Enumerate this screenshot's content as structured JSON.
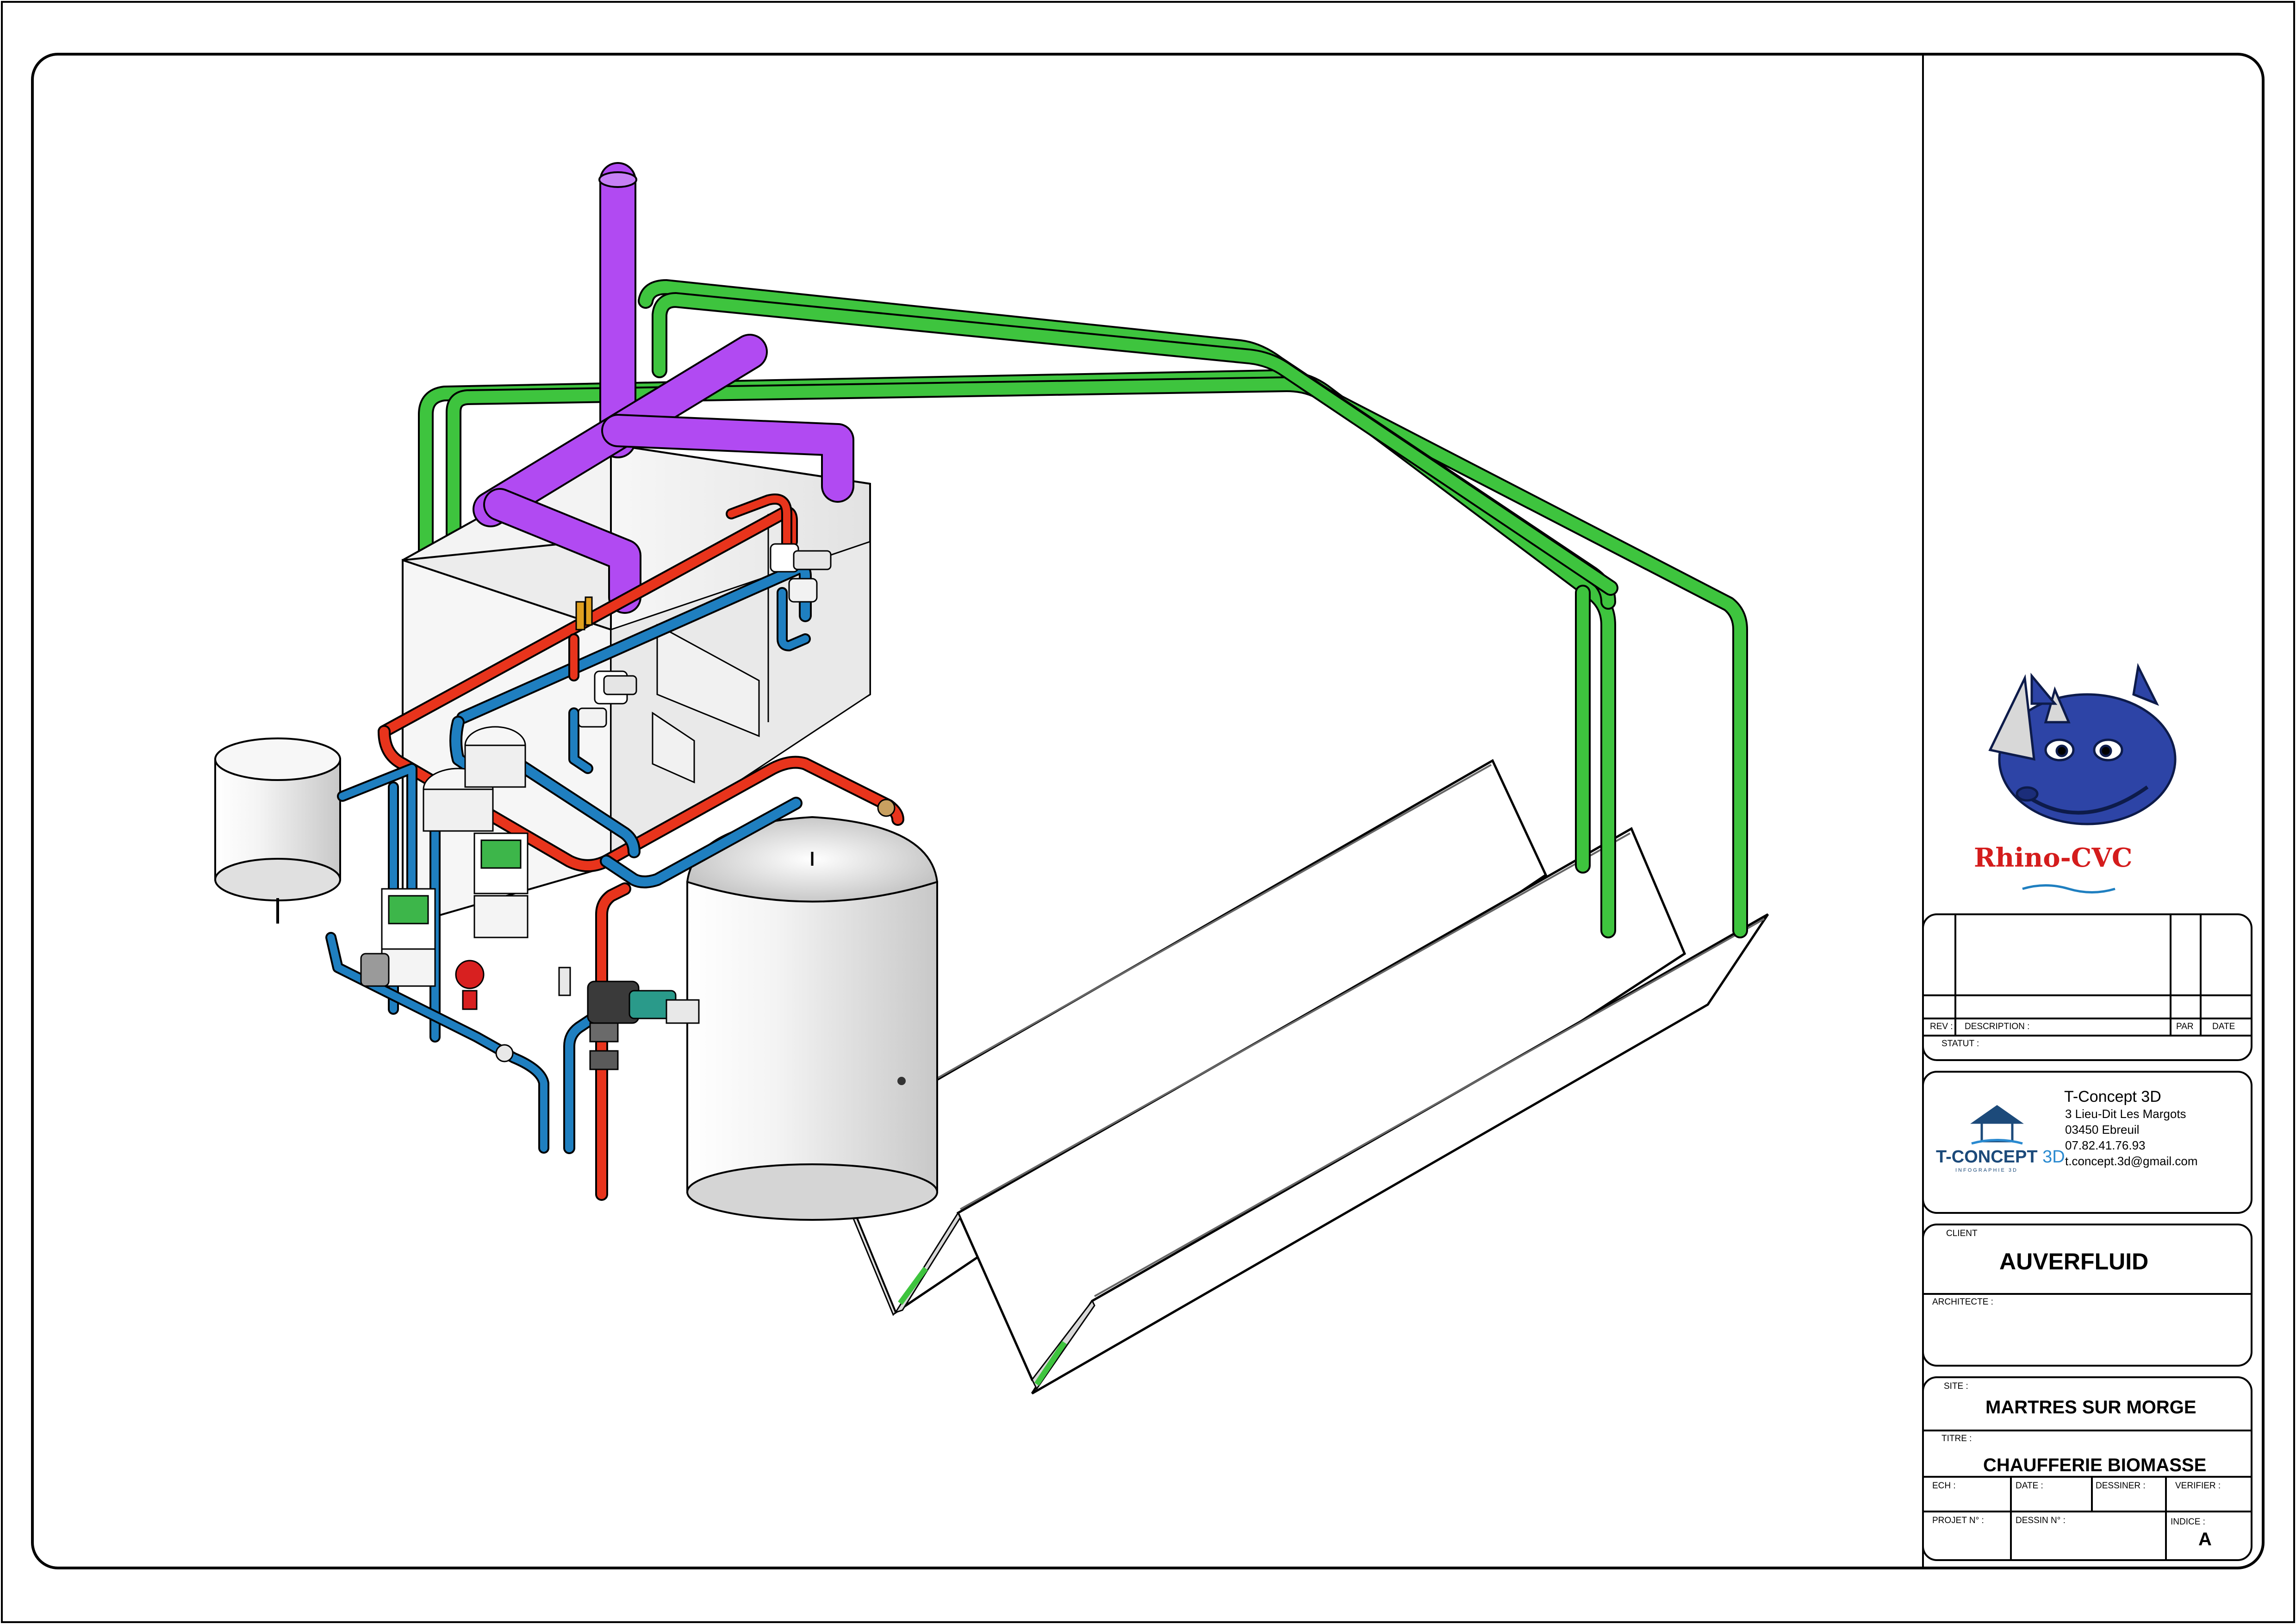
{
  "drawing": {
    "pipe_colors": {
      "flow": "#e8341c",
      "return": "#1f7fc0",
      "solar_loop": "#3ec43e",
      "flue": "#b14af2",
      "casing": "#f0f0f0"
    }
  },
  "logo": {
    "brand": "Rhino-CVC",
    "icon": "rhino-icon",
    "brand_color": "#d41c1c",
    "rhino_color": "#2d44a6"
  },
  "revision_block": {
    "rev_label": "REV :",
    "description_label": "DESCRIPTION :",
    "par_label": "PAR",
    "date_label": "DATE",
    "statut_label": "STATUT :"
  },
  "company": {
    "name": "T-Concept 3D",
    "address_line1": "3 Lieu-Dit Les Margots",
    "address_line2": "03450 Ebreuil",
    "phone": "07.82.41.76.93",
    "email": "t.concept.3d@gmail.com",
    "logo_main": "T-CONCEPT",
    "logo_suffix": " 3D",
    "logo_tagline": "INFOGRAPHIE 3D",
    "logo_icon": "house-icon",
    "logo_color": "#1c4a7a"
  },
  "client_block": {
    "client_label": "CLIENT",
    "client_value": "AUVERFLUID",
    "architecte_label": "ARCHITECTE :"
  },
  "project_block": {
    "site_label": "SITE :",
    "site_value": "MARTRES SUR MORGE",
    "titre_label": "TITRE :",
    "titre_value": "CHAUFFERIE BIOMASSE",
    "ech_label": "ECH :",
    "date_label": "DATE :",
    "dessiner_label": "DESSINER :",
    "verifier_label": "VERIFIER :",
    "projet_label": "PROJET N° :",
    "dessin_label": "DESSIN N° :",
    "indice_label": "INDICE :",
    "indice_value": "A"
  }
}
